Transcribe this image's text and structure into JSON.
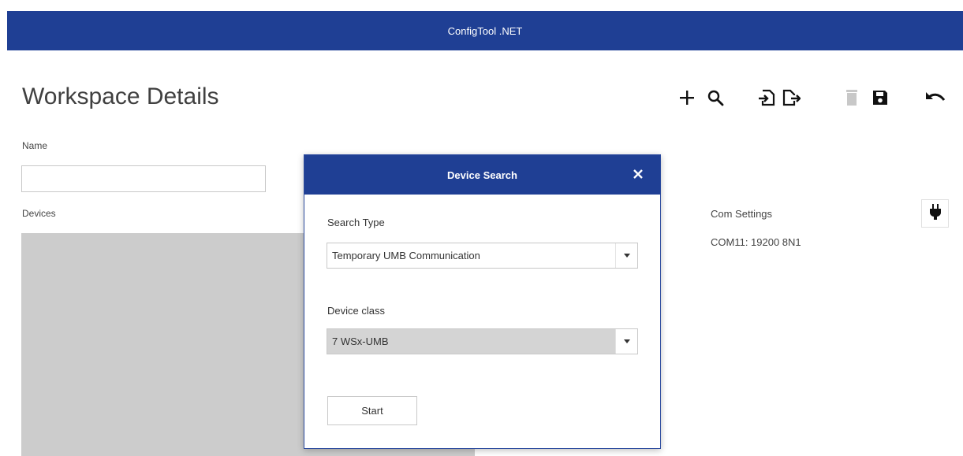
{
  "app": {
    "title": "ConfigTool .NET"
  },
  "page": {
    "title": "Workspace Details"
  },
  "toolbar": {
    "buttons": [
      {
        "name": "add",
        "icon": "plus-icon",
        "enabled": true
      },
      {
        "name": "search",
        "icon": "search-icon",
        "enabled": true
      },
      {
        "name": "import",
        "icon": "import-icon",
        "enabled": true
      },
      {
        "name": "export",
        "icon": "export-icon",
        "enabled": true
      },
      {
        "name": "delete",
        "icon": "trash-icon",
        "enabled": false
      },
      {
        "name": "save",
        "icon": "floppy-disk-icon",
        "enabled": true
      },
      {
        "name": "undo",
        "icon": "undo-icon",
        "enabled": true
      }
    ]
  },
  "form": {
    "name_label": "Name",
    "name_value": "",
    "devices_label": "Devices"
  },
  "com": {
    "label": "Com Settings",
    "value": "COM11: 19200 8N1",
    "icon": "plug-icon"
  },
  "dialog": {
    "title": "Device Search",
    "close_icon": "close-icon",
    "search_type_label": "Search Type",
    "search_type_value": "Temporary UMB Communication",
    "device_class_label": "Device class",
    "device_class_value": "7 WSx-UMB",
    "start_label": "Start"
  },
  "colors": {
    "header_blue": "#1f3f94",
    "list_grey": "#cccccc",
    "disabled_icon": "#c8c8c8"
  }
}
